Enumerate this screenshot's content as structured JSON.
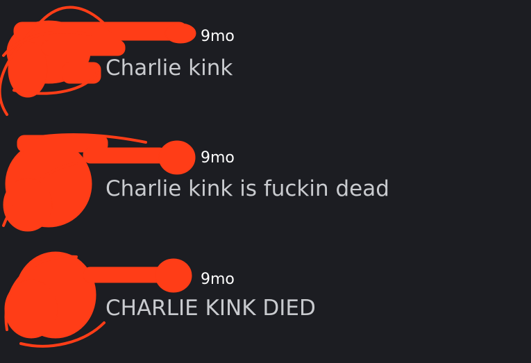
{
  "colors": {
    "background": "#1c1d22",
    "message_text": "#c9cbcf",
    "timestamp_text": "#ffffff",
    "redaction": "#ff3d17"
  },
  "messages": [
    {
      "timestamp": "9mo",
      "content": "Charlie kink"
    },
    {
      "timestamp": "9mo",
      "content": "Charlie kink is fuckin dead"
    },
    {
      "timestamp": "9mo",
      "content": "CHARLIE KINK DIED"
    }
  ]
}
